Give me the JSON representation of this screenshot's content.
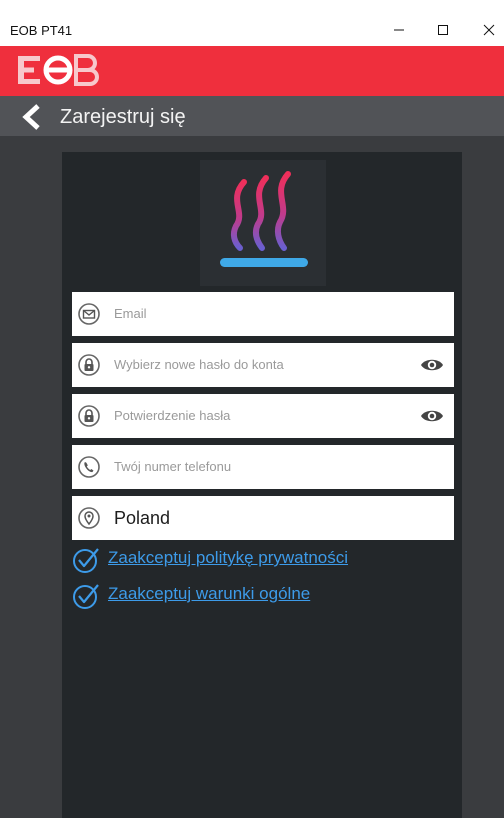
{
  "window": {
    "title": "EOB PT41",
    "minimize_icon": "minimize-icon",
    "maximize_icon": "maximize-icon",
    "close_icon": "close-icon"
  },
  "brand": {
    "logo_text": "EOB",
    "header_color": "#ef2f3d"
  },
  "nav": {
    "back_icon": "chevron-left-icon",
    "title": "Zarejestruj się"
  },
  "app_logo": {
    "icon": "heat-waves-icon"
  },
  "form": {
    "email": {
      "icon": "envelope-icon",
      "placeholder": "Email"
    },
    "password": {
      "icon": "lock-icon",
      "placeholder": "Wybierz nowe hasło do konta",
      "toggle_icon": "eye-icon"
    },
    "password_confirm": {
      "icon": "lock-icon",
      "placeholder": "Potwierdzenie hasła",
      "toggle_icon": "eye-icon"
    },
    "phone": {
      "icon": "phone-icon",
      "placeholder": "Twój numer telefonu"
    },
    "country": {
      "icon": "location-pin-icon",
      "value": "Poland"
    }
  },
  "agreements": [
    {
      "icon": "check-circle-icon",
      "label": "Zaakceptuj politykę prywatności"
    },
    {
      "icon": "check-circle-icon",
      "label": "Zaakceptuj warunki ogólne"
    }
  ],
  "colors": {
    "link": "#3d9be9",
    "panel": "#23272a",
    "background": "#3a3c3f"
  }
}
